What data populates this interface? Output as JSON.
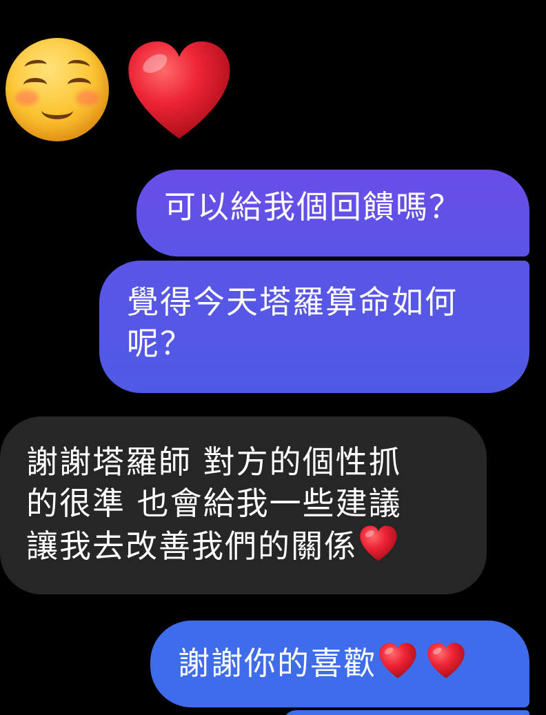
{
  "emojis": {
    "reaction_smile": "smiling-face-with-closed-eyes",
    "reaction_heart": "red-heart"
  },
  "messages": [
    {
      "direction": "outgoing",
      "lines": [
        "可以給我個回饋嗎？"
      ]
    },
    {
      "direction": "outgoing",
      "lines": [
        "覺得今天塔羅算命如何",
        "呢？"
      ]
    },
    {
      "direction": "incoming",
      "lines": [
        "謝謝塔羅師 對方的個性抓",
        "的很準 也會給我一些建議",
        "讓我去改善我們的關係"
      ],
      "trailing_emoji": "red-heart"
    },
    {
      "direction": "outgoing",
      "lines": [
        "謝謝你的喜歡"
      ],
      "trailing_emoji": [
        "red-heart",
        "red-heart"
      ]
    }
  ],
  "colors": {
    "background": "#000000",
    "outgoing_bubble_top": "#6a4de8",
    "outgoing_bubble_mid": "#5458e5",
    "outgoing_bubble_bottom": "#3f6cea",
    "incoming_bubble": "#262626",
    "text": "#ffffff",
    "heart": "#e0192a"
  }
}
